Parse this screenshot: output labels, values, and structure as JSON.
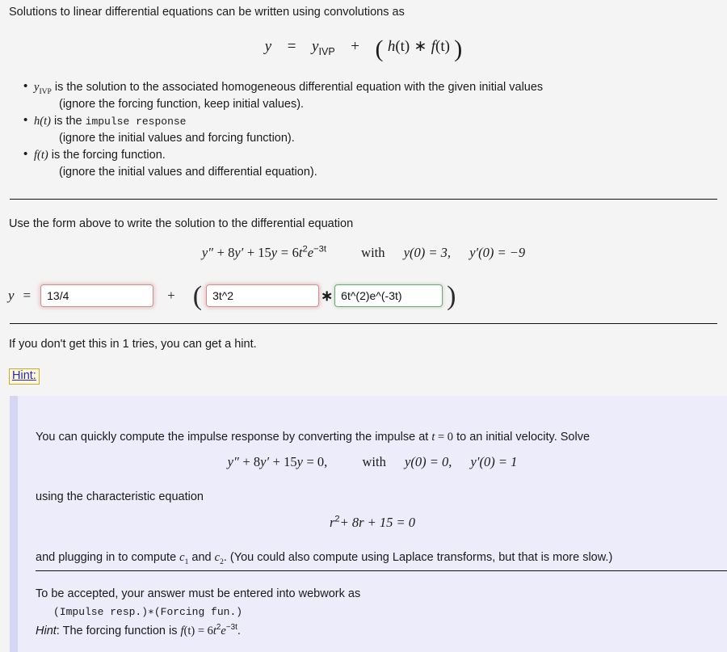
{
  "intro": {
    "line": "Solutions to linear differential equations can be written using convolutions as",
    "equation": {
      "lhs": "y",
      "eq": "=",
      "yivp": "y",
      "yivp_sub": "IVP",
      "plus": "+",
      "open_paren": "(",
      "h": "h",
      "h_arg": "(t)",
      "conv": "∗",
      "f": "f",
      "f_arg": "(t)",
      "close_paren": ")"
    }
  },
  "bullets": [
    {
      "symbol": "y",
      "symbol_sub": "IVP",
      "text": " is the solution to the associated homogeneous differential equation with the given initial values",
      "note": "(ignore the forcing function, keep initial values)."
    },
    {
      "symbol": "h(t)",
      "text_pre": " is the ",
      "mono_text": "impulse response",
      "note": "(ignore the initial values and forcing function)."
    },
    {
      "symbol": "f(t)",
      "text": " is the forcing function.",
      "note": "(ignore the initial values and differential equation)."
    }
  ],
  "problem": {
    "prompt": "Use the form above to write the solution to the differential equation",
    "ode": {
      "y2": "y",
      "y2_prime": "″",
      "plus1": "+ 8",
      "y1": "y",
      "y1_prime": "′",
      "plus2": "+ 15",
      "y0": "y",
      "equals": "=",
      "rhs_coef": "6",
      "rhs_t": "t",
      "rhs_t_exp": "2",
      "rhs_e": "e",
      "rhs_e_exp": "−3t",
      "with": "with",
      "ic1": "y(0) = 3,",
      "ic2_y": "y",
      "ic2_prime": "′",
      "ic2_rest": "(0) = −9"
    }
  },
  "answer": {
    "y_label": "y",
    "equals": "=",
    "plus": "+",
    "open_paren": "(",
    "star": "∗",
    "close_paren": ")",
    "fields": [
      {
        "name": "yivp-field",
        "value": "13/4",
        "placeholder": "",
        "status": "wrong"
      },
      {
        "name": "impulse-response-field",
        "value": "3t^2",
        "placeholder": "",
        "status": "wrong"
      },
      {
        "name": "forcing-function-field",
        "value": "6t^(2)e^(-3t)",
        "placeholder": "",
        "status": "right"
      }
    ],
    "status_colors": {
      "wrong_border": "#d98a8e",
      "wrong_glow": "rgba(220,140,145,0.45)",
      "right_border": "#6aaa6e",
      "right_glow": "rgba(120,180,120,0.35)"
    }
  },
  "tries": {
    "text": "If you don't get this in 1 tries, you can get a hint.",
    "hint_link": "Hint:",
    "hint_link_color": "#2a2ab0",
    "hint_link_bg": "#fbf6d9",
    "hint_link_border": "#c8ad2a"
  },
  "hint": {
    "panel_bg": "#ececfb",
    "panel_border": "#d5d5f4",
    "para1_a": "You can quickly compute the impulse response by converting the impulse at ",
    "para1_t": "t",
    "para1_eq": " = 0",
    "para1_b": " to an initial velocity. Solve",
    "eq1": {
      "y2": "y",
      "y2_prime": "″",
      "plus1": "+ 8",
      "y1": "y",
      "y1_prime": "′",
      "plus2": "+ 15",
      "y0": "y",
      "equals": "= 0,",
      "with": "with",
      "ic1": "y(0) = 0,",
      "ic2_y": "y",
      "ic2_prime": "′",
      "ic2_rest": "(0) = 1"
    },
    "para2": "using the characteristic equation",
    "eq2": {
      "r": "r",
      "r_exp": "2",
      "rest": "+ 8r + 15 = 0"
    },
    "para3_a": "and plugging in to compute ",
    "para3_c1": "c",
    "para3_c1_sub": "1",
    "para3_mid": " and ",
    "para3_c2": "c",
    "para3_c2_sub": "2",
    "para3_b": ". (You could also compute using Laplace transforms, but that is more slow.)",
    "footer1": "To be accepted, your answer must be entered into webwork as",
    "footer2": "(Impulse resp.)∗(Forcing fun.)",
    "footer3_hint": "Hint",
    "footer3_a": ": The forcing function is ",
    "footer3_f": "f",
    "footer3_arg": "(t)",
    "footer3_eq": " = 6",
    "footer3_t": "t",
    "footer3_t_exp": "2",
    "footer3_e": "e",
    "footer3_e_exp": "−3t",
    "footer3_end": "."
  }
}
